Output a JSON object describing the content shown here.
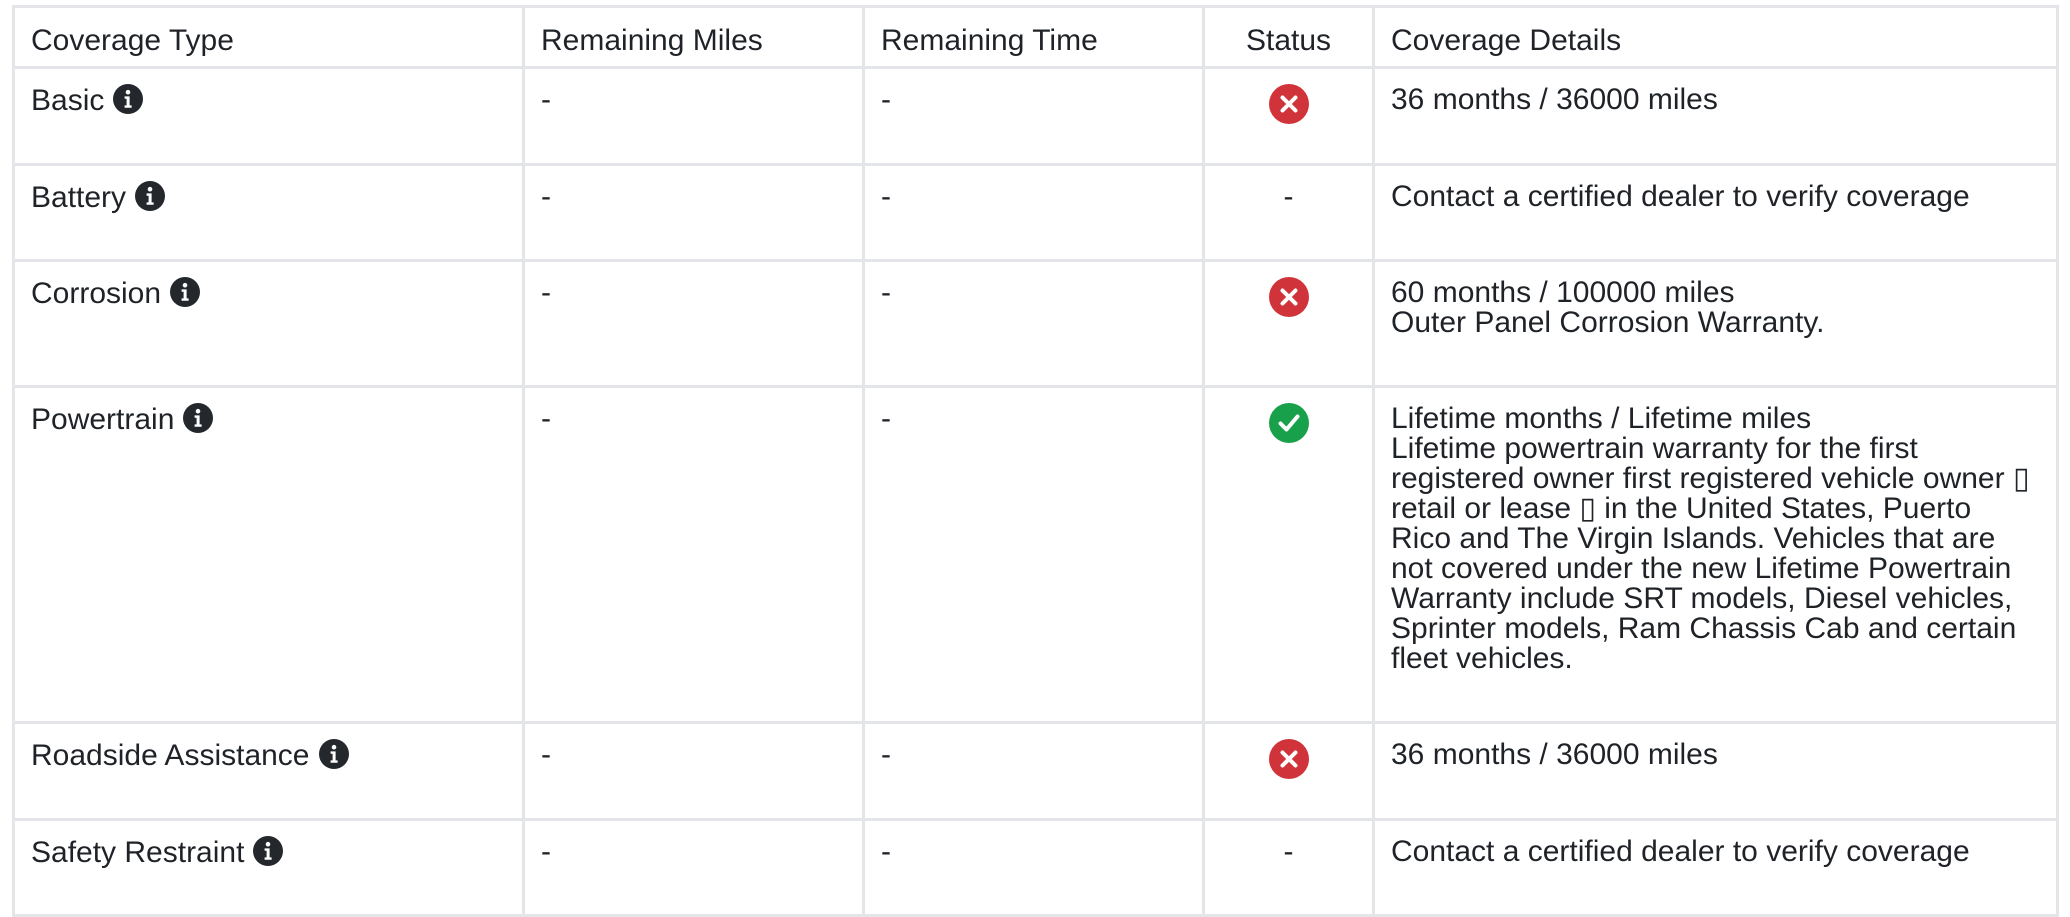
{
  "table": {
    "headers": {
      "coverage_type": "Coverage Type",
      "remaining_miles": "Remaining Miles",
      "remaining_time": "Remaining Time",
      "status": "Status",
      "coverage_details": "Coverage Details"
    },
    "rows": [
      {
        "type": "Basic",
        "remaining_miles": "-",
        "remaining_time": "-",
        "status": "expired",
        "status_text": "",
        "details": [
          "36 months / 36000 miles"
        ]
      },
      {
        "type": "Battery",
        "remaining_miles": "-",
        "remaining_time": "-",
        "status": "none",
        "status_text": "-",
        "details": [
          "Contact a certified dealer to verify coverage"
        ]
      },
      {
        "type": "Corrosion",
        "remaining_miles": "-",
        "remaining_time": "-",
        "status": "expired",
        "status_text": "",
        "details": [
          "60 months / 100000 miles",
          "Outer Panel Corrosion Warranty."
        ]
      },
      {
        "type": "Powertrain",
        "remaining_miles": "-",
        "remaining_time": "-",
        "status": "active",
        "status_text": "",
        "details": [
          "Lifetime months / Lifetime miles",
          "Lifetime powertrain warranty for the first registered owner first registered vehicle owner ▯ retail or lease ▯ in the United States, Puerto Rico and The Virgin Islands. Vehicles that are not covered under the new Lifetime Powertrain Warranty include SRT models, Diesel vehicles, Sprinter models, Ram Chassis Cab and certain fleet vehicles."
        ]
      },
      {
        "type": "Roadside Assistance",
        "remaining_miles": "-",
        "remaining_time": "-",
        "status": "expired",
        "status_text": "",
        "details": [
          "36 months / 36000 miles"
        ]
      },
      {
        "type": "Safety Restraint",
        "remaining_miles": "-",
        "remaining_time": "-",
        "status": "none",
        "status_text": "-",
        "details": [
          "Contact a certified dealer to verify coverage"
        ]
      }
    ]
  },
  "icons": {
    "info": "info-circle-icon",
    "expired": "x-circle-icon",
    "active": "check-circle-icon"
  },
  "colors": {
    "expired": "#d0343a",
    "active": "#18a04a",
    "info": "#24282d",
    "border": "#e3e5e8",
    "text": "#1f2328"
  }
}
